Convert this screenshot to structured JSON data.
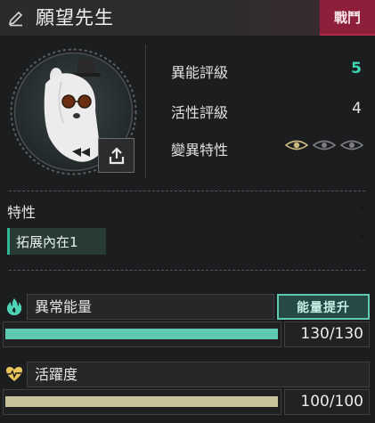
{
  "header": {
    "title": "願望先生",
    "tag": "戰鬥",
    "tag_color": "#8e1f3a"
  },
  "portrait": {
    "subject": "alpaca-with-top-hat-and-sunglasses",
    "export_icon": "share-upload-icon"
  },
  "stats": [
    {
      "label": "異能評級",
      "value": "5",
      "color": "#3fd6b4"
    },
    {
      "label": "活性評級",
      "value": "4",
      "color": "#e6e6e6"
    }
  ],
  "mutation": {
    "label": "變異特性",
    "eyes": [
      {
        "active": true,
        "color": "#c9b980"
      },
      {
        "active": false,
        "color": "#7b7d80"
      },
      {
        "active": false,
        "color": "#7b7d80"
      }
    ]
  },
  "traits": {
    "title": "特性",
    "items": [
      "拓展內在1"
    ],
    "accent": "#2fb592"
  },
  "energy": {
    "label": "異常能量",
    "button": "能量提升",
    "value_text": "130/130",
    "fraction": 1.0,
    "fill_color": "#5dc9b1",
    "icon": "flame-icon"
  },
  "vitality": {
    "label": "活躍度",
    "value_text": "100/100",
    "fraction": 1.0,
    "fill_color": "#c8c39a",
    "icon": "heart-pulse-icon"
  }
}
